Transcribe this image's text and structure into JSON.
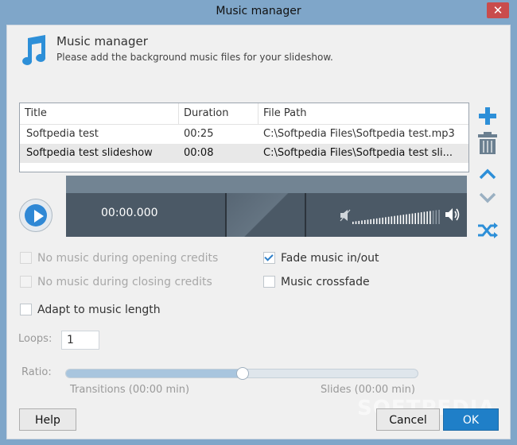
{
  "window": {
    "title": "Music manager",
    "close_glyph": "✕"
  },
  "header": {
    "title": "Music manager",
    "subtitle": "Please add the background music files for your slideshow."
  },
  "table": {
    "columns": [
      "Title",
      "Duration",
      "File Path"
    ],
    "rows": [
      {
        "title": "Softpedia test",
        "duration": "00:25",
        "path": "C:\\Softpedia Files\\Softpedia test.mp3"
      },
      {
        "title": "Softpedia test slideshow",
        "duration": "00:08",
        "path": "C:\\Softpedia Files\\Softpedia test sli..."
      }
    ]
  },
  "player": {
    "time": "00:00.000",
    "volume": 0.9
  },
  "options": {
    "no_music_opening": {
      "label": "No music during opening credits",
      "checked": false,
      "enabled": false
    },
    "no_music_closing": {
      "label": "No music during closing credits",
      "checked": false,
      "enabled": false
    },
    "fade": {
      "label": "Fade music in/out",
      "checked": true,
      "enabled": true
    },
    "crossfade": {
      "label": "Music crossfade",
      "checked": false,
      "enabled": true
    },
    "adapt": {
      "label": "Adapt to music length",
      "checked": false,
      "enabled": true
    }
  },
  "loops": {
    "label": "Loops:",
    "value": "1"
  },
  "ratio": {
    "label": "Ratio:",
    "value": 0.5,
    "left_label": "Transitions (00:00 min)",
    "right_label": "Slides (00:00 min)"
  },
  "buttons": {
    "help": "Help",
    "cancel": "Cancel",
    "ok": "OK"
  },
  "watermark": "SOFTPEDIA",
  "colors": {
    "accent": "#2d8fd8",
    "player_bg": "#4b5966",
    "ok_bg": "#1f7fc8"
  },
  "icons": {
    "add": "plus-icon",
    "delete": "trash-icon",
    "up": "chevron-up-icon",
    "down": "chevron-down-icon",
    "shuffle": "shuffle-icon",
    "play": "play-icon",
    "volume_low": "speaker-low-icon",
    "volume_high": "speaker-high-icon",
    "music": "music-note-icon"
  }
}
